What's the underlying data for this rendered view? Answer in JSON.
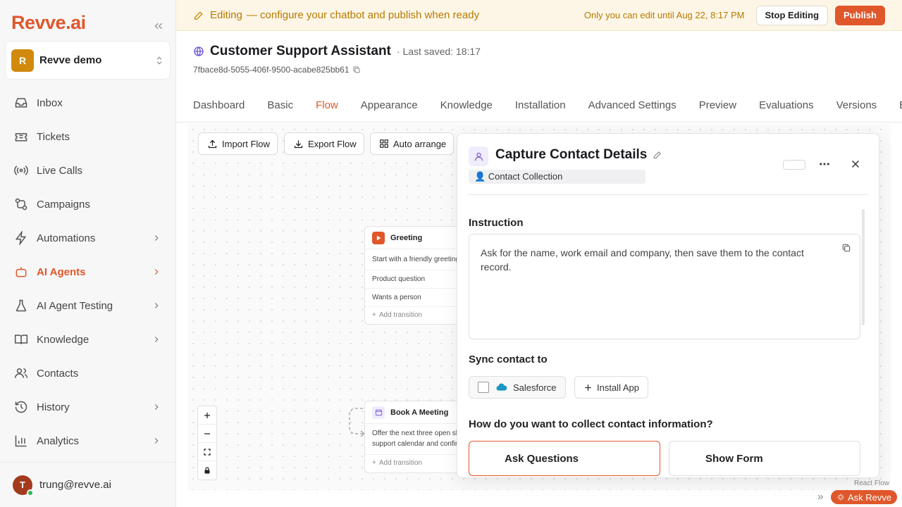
{
  "sidebar": {
    "logo": "Revve.ai",
    "workspace": {
      "initial": "R",
      "name": "Revve demo"
    },
    "items": [
      {
        "label": "Inbox",
        "icon": "inbox-icon",
        "chevron": false
      },
      {
        "label": "Tickets",
        "icon": "ticket-icon",
        "chevron": false
      },
      {
        "label": "Live Calls",
        "icon": "live-calls-icon",
        "chevron": false
      },
      {
        "label": "Campaigns",
        "icon": "campaigns-icon",
        "chevron": false
      },
      {
        "label": "Automations",
        "icon": "lightning-icon",
        "chevron": true
      },
      {
        "label": "AI Agents",
        "icon": "robot-icon",
        "chevron": true,
        "active": true
      },
      {
        "label": "AI Agent Testing",
        "icon": "flask-icon",
        "chevron": true
      },
      {
        "label": "Knowledge",
        "icon": "book-icon",
        "chevron": true
      },
      {
        "label": "Contacts",
        "icon": "users-icon",
        "chevron": false
      },
      {
        "label": "History",
        "icon": "history-icon",
        "chevron": true
      },
      {
        "label": "Analytics",
        "icon": "chart-icon",
        "chevron": true
      }
    ],
    "user": {
      "initial": "T",
      "email": "trung@revve.ai",
      "status": "online"
    }
  },
  "banner": {
    "title": "Editing",
    "subtitle": "— configure your chatbot and publish when ready",
    "until": "Only you can edit until Aug 22, 8:17 PM",
    "stop_label": "Stop Editing",
    "publish_label": "Publish"
  },
  "header": {
    "title": "Customer Support Assistant",
    "saved": "· Last saved: 18:17",
    "bot_id": "7fbace8d-5055-406f-9500-acabe825bb61"
  },
  "tabs": [
    "Dashboard",
    "Basic",
    "Flow",
    "Appearance",
    "Knowledge",
    "Installation",
    "Advanced Settings",
    "Preview",
    "Evaluations",
    "Versions",
    "Expe"
  ],
  "active_tab": "Flow",
  "toolbar": {
    "import_label": "Import Flow",
    "export_label": "Export Flow",
    "arrange_label": "Auto arrange"
  },
  "nodes": {
    "greeting": {
      "title": "Greeting",
      "description": "Start with a friendly greeting",
      "transitions": [
        "Product question",
        "Wants a person"
      ],
      "add_label": "Add transition"
    },
    "meeting": {
      "title": "Book A Meeting",
      "description_1": "Offer the next three open sl",
      "description_2": "support calendar and confir",
      "add_label": "Add transition"
    }
  },
  "react_flow_label": "React Flow",
  "panel": {
    "title": "Capture Contact Details",
    "badge": "👤 Contact Collection",
    "instruction_label": "Instruction",
    "instruction_text": "Ask for the name, work email and company, then save them to the contact record.",
    "sync_label": "Sync contact to",
    "salesforce_label": "Salesforce",
    "salesforce_checked": false,
    "install_label": "Install App",
    "collect_label": "How do you want to collect contact information?",
    "option_ask": "Ask Questions",
    "option_form": "Show Form",
    "selected_option": "Ask Questions"
  },
  "ask_revve_label": "Ask Revve",
  "colors": {
    "accent": "#e0572b",
    "banner_bg": "#fdf6e6",
    "banner_text": "#b77a00"
  }
}
